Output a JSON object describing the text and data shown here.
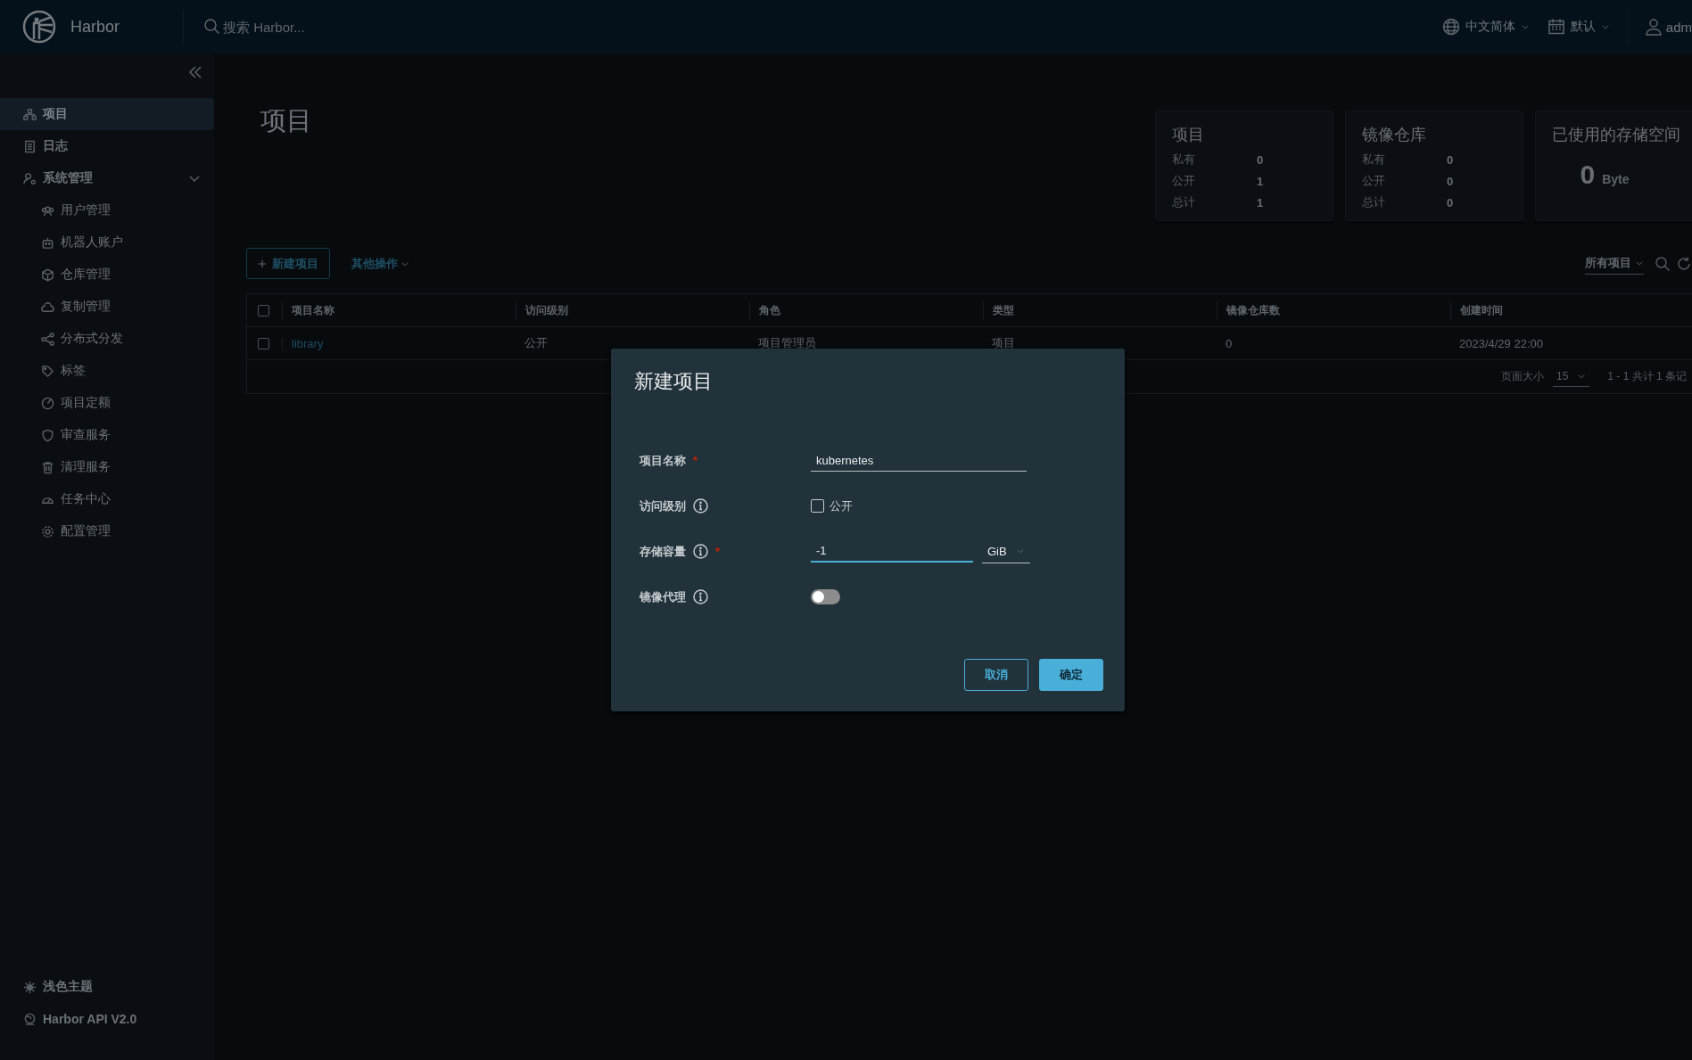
{
  "header": {
    "product": "Harbor",
    "search": {
      "placeholder": "搜索 Harbor..."
    },
    "language": "中文简体",
    "theme": "默认",
    "user": "adm"
  },
  "sidebar": {
    "items": [
      {
        "label": "项目",
        "selected": true
      },
      {
        "label": "日志",
        "selected": false
      },
      {
        "label": "系统管理",
        "selected": false,
        "expanded": true,
        "children": [
          {
            "label": "用户管理",
            "selected": false
          },
          {
            "label": "机器人账户",
            "selected": false
          },
          {
            "label": "仓库管理",
            "selected": false
          },
          {
            "label": "复制管理",
            "selected": false
          },
          {
            "label": "分布式分发",
            "selected": false
          },
          {
            "label": "标签",
            "selected": false
          },
          {
            "label": "项目定额",
            "selected": false
          },
          {
            "label": "审查服务",
            "selected": false
          },
          {
            "label": "清理服务",
            "selected": false
          },
          {
            "label": "任务中心",
            "selected": false
          },
          {
            "label": "配置管理",
            "selected": false
          }
        ]
      }
    ],
    "footer": [
      "浅色主题",
      "Harbor API V2.0"
    ]
  },
  "page": {
    "title": "项目",
    "stats": [
      {
        "title": "项目",
        "rows": [
          {
            "label": "私有",
            "value": "0"
          },
          {
            "label": "公开",
            "value": "1"
          },
          {
            "label": "总计",
            "value": "1"
          }
        ]
      },
      {
        "title": "镜像仓库",
        "rows": [
          {
            "label": "私有",
            "value": "0"
          },
          {
            "label": "公开",
            "value": "0"
          },
          {
            "label": "总计",
            "value": "0"
          }
        ]
      }
    ],
    "storage": {
      "title": "已使用的存储空间",
      "value": "0",
      "unit": "Byte"
    }
  },
  "toolbar": {
    "new_button": "新建项目",
    "more_actions": "其他操作",
    "filter": "所有项目"
  },
  "table": {
    "all_checked": false,
    "columns": [
      "项目名称",
      "访问级别",
      "角色",
      "类型",
      "镜像仓库数",
      "创建时间"
    ],
    "rows": [
      {
        "selected": false,
        "cells": [
          "library",
          "公开",
          "项目管理员",
          "项目",
          "0",
          "2023/4/29 22:00"
        ]
      }
    ],
    "page_size_label": "页面大小",
    "page_size": "15",
    "summary": "1 - 1 共计 1 条记"
  },
  "dialog": {
    "title": "新建项目",
    "required_mark": "*",
    "fields": [
      {
        "kind": "text",
        "label": "项目名称",
        "info": false,
        "required": true,
        "value": "kubernetes"
      },
      {
        "kind": "checkbox",
        "label": "访问级别",
        "info": true,
        "required": false,
        "option": "公开",
        "checked": false
      },
      {
        "kind": "quota",
        "label": "存储容量",
        "info": true,
        "required": true,
        "value": "-1",
        "unit": "GiB"
      },
      {
        "kind": "toggle",
        "label": "镜像代理",
        "info": true,
        "required": false,
        "on": false
      }
    ],
    "buttons": [
      {
        "label": "取消",
        "kind": "secondary"
      },
      {
        "label": "确定",
        "kind": "primary"
      }
    ]
  }
}
